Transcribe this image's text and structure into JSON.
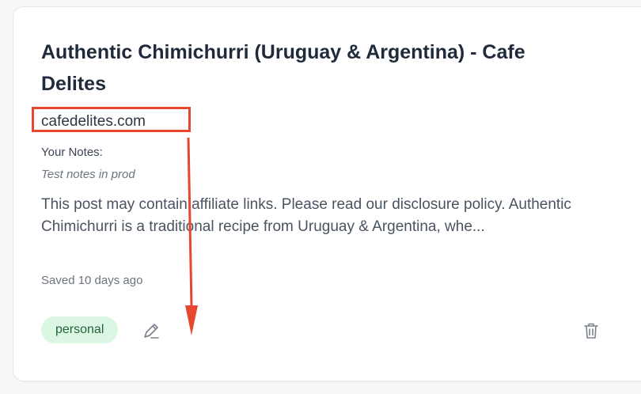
{
  "card": {
    "title": "Authentic Chimichurri (Uruguay & Argentina) - Cafe Delites",
    "domain": "cafedelites.com",
    "notes_label": "Your Notes:",
    "notes_text": "Test notes in prod",
    "excerpt": "This post may contain affiliate links. Please read our disclosure policy. Authentic Chimichurri is a traditional recipe from Uruguay & Argentina, whe...",
    "saved": "Saved 10 days ago",
    "tag": "personal",
    "edit_icon": "pencil-icon",
    "delete_icon": "trash-icon"
  },
  "annotation": {
    "color": "#e5472f"
  }
}
